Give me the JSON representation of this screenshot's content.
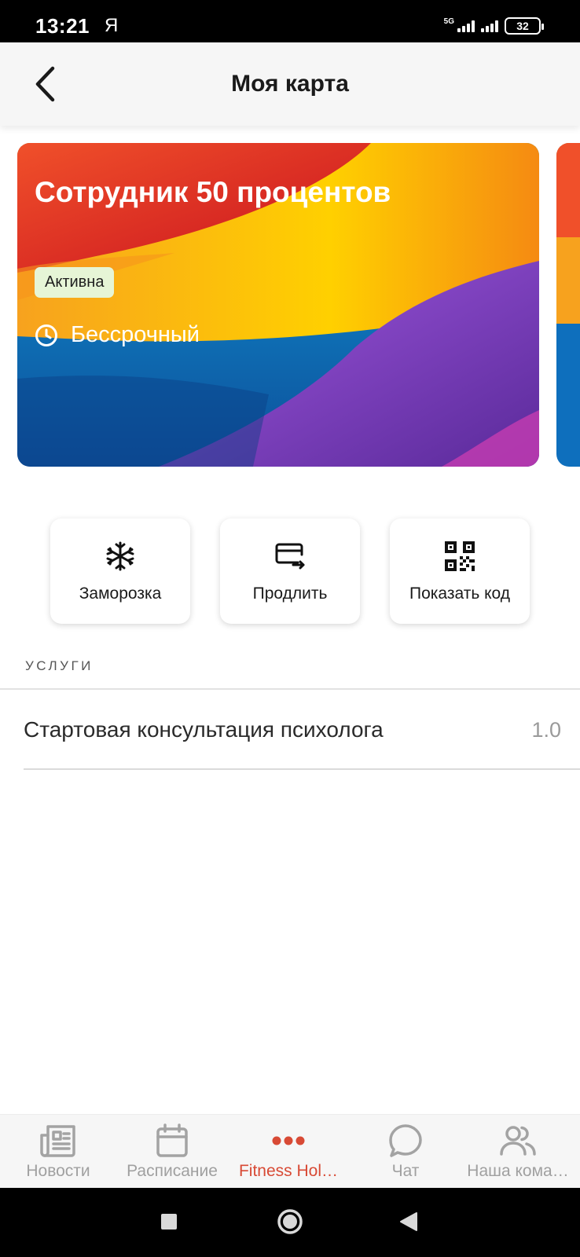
{
  "status_bar": {
    "time": "13:21",
    "carrier_app": "Я",
    "network": "5G",
    "battery": "32"
  },
  "header": {
    "title": "Моя карта",
    "back_icon": "chevron-left-icon"
  },
  "cards": [
    {
      "title": "Сотрудник 50 процентов",
      "status": "Активна",
      "validity": "Бессрочный",
      "validity_icon": "clock-icon",
      "gradient_colors": [
        "#e8262a",
        "#ffcc00",
        "#f7941d",
        "#0b8fd6",
        "#7b3fc4",
        "#a64ee6"
      ]
    }
  ],
  "actions": [
    {
      "label": "Заморозка",
      "icon": "snowflake-icon"
    },
    {
      "label": "Продлить",
      "icon": "card-extend-icon"
    },
    {
      "label": "Показать код",
      "icon": "qr-code-icon"
    }
  ],
  "services": {
    "section_title": "УСЛУГИ",
    "items": [
      {
        "name": "Стартовая консультация психолога",
        "quantity": "1.0"
      }
    ]
  },
  "bottom_nav": {
    "items": [
      {
        "label": "Новости",
        "icon": "news-icon",
        "active": false
      },
      {
        "label": "Расписание",
        "icon": "calendar-icon",
        "active": false
      },
      {
        "label": "Fitness Hol…",
        "icon": "more-dots-icon",
        "active": true
      },
      {
        "label": "Чат",
        "icon": "chat-icon",
        "active": false
      },
      {
        "label": "Наша кома…",
        "icon": "team-icon",
        "active": false
      }
    ],
    "active_color": "#d84a35",
    "inactive_color": "#a0a0a0"
  },
  "system_nav": {
    "buttons": [
      "recents-square-icon",
      "home-circle-icon",
      "back-triangle-icon"
    ]
  }
}
